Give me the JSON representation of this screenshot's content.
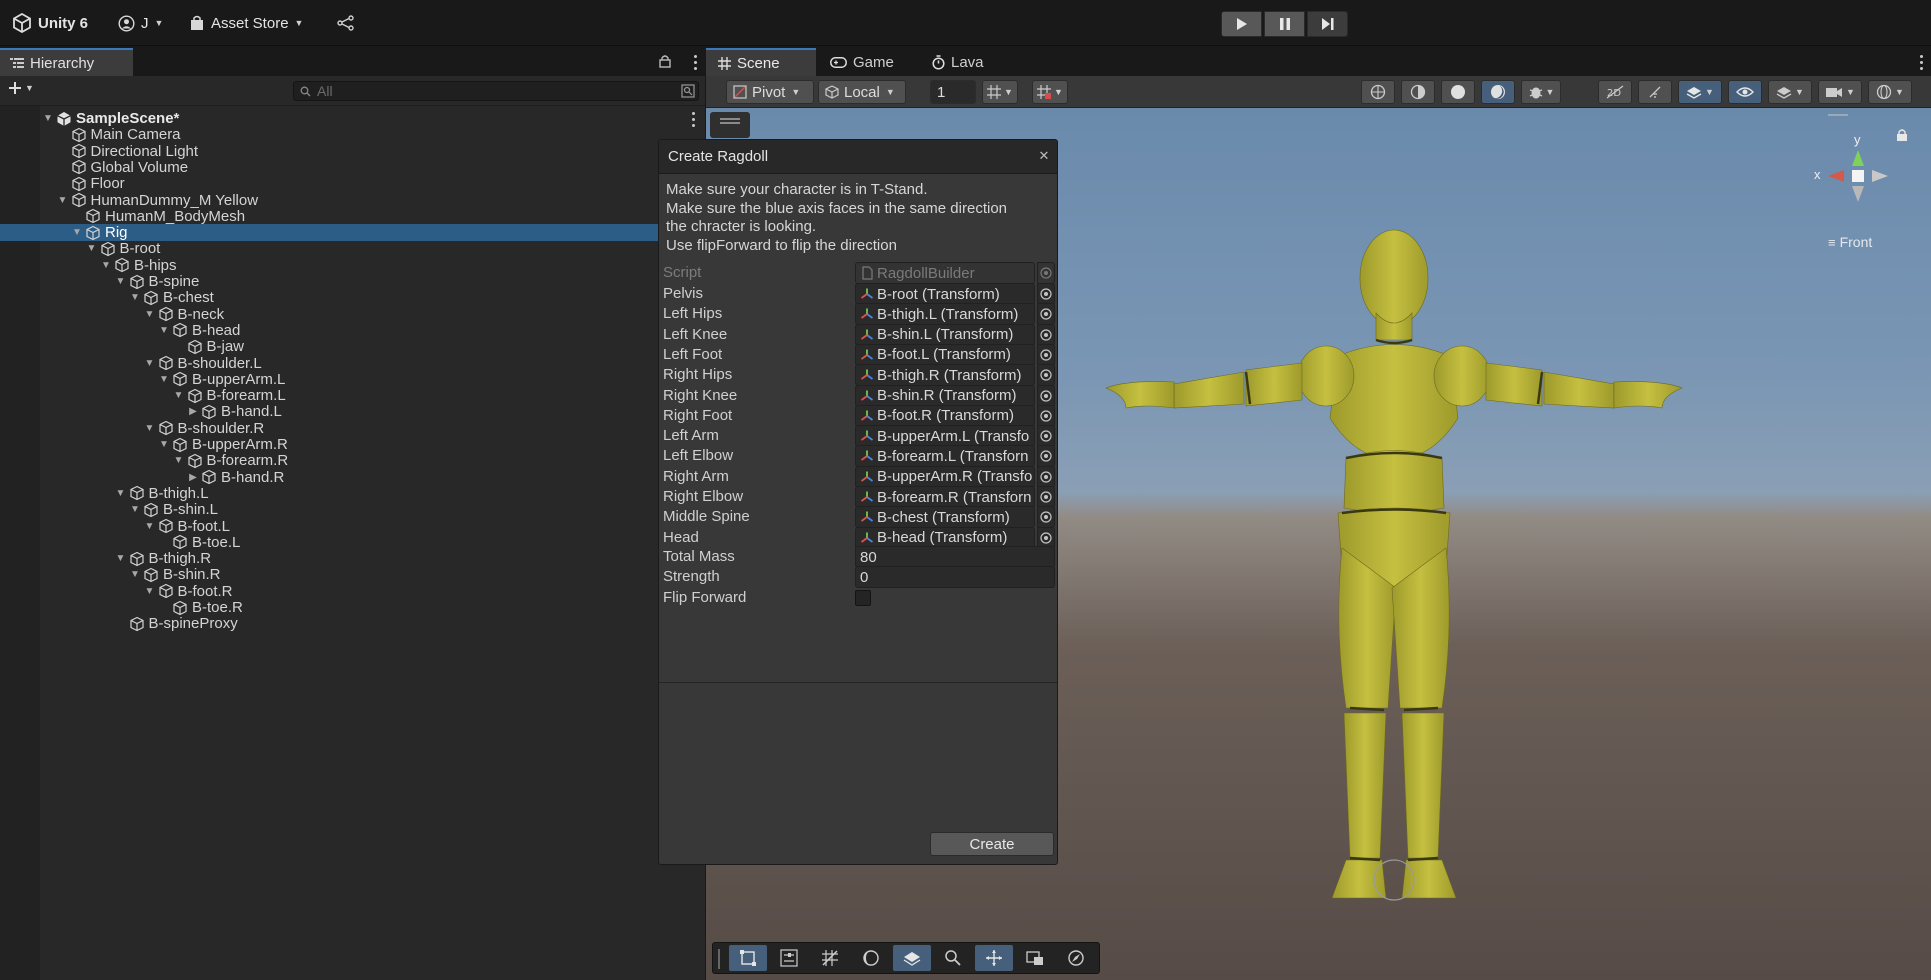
{
  "topbar": {
    "unity_label": "Unity 6",
    "account_label": "J",
    "asset_store_label": "Asset Store"
  },
  "hierarchy": {
    "tab_label": "Hierarchy",
    "search_placeholder": "All",
    "rows": [
      {
        "label": "SampleScene*",
        "depth": 0,
        "arrow": "down",
        "kind": "scene"
      },
      {
        "label": "Main Camera",
        "depth": 1,
        "arrow": "",
        "kind": "go"
      },
      {
        "label": "Directional Light",
        "depth": 1,
        "arrow": "",
        "kind": "go"
      },
      {
        "label": "Global Volume",
        "depth": 1,
        "arrow": "",
        "kind": "go"
      },
      {
        "label": "Floor",
        "depth": 1,
        "arrow": "",
        "kind": "go"
      },
      {
        "label": "HumanDummy_M Yellow",
        "depth": 1,
        "arrow": "down",
        "kind": "go"
      },
      {
        "label": "HumanM_BodyMesh",
        "depth": 2,
        "arrow": "",
        "kind": "go"
      },
      {
        "label": "Rig",
        "depth": 2,
        "arrow": "down",
        "kind": "go",
        "selected": true
      },
      {
        "label": "B-root",
        "depth": 3,
        "arrow": "down",
        "kind": "go"
      },
      {
        "label": "B-hips",
        "depth": 4,
        "arrow": "down",
        "kind": "go"
      },
      {
        "label": "B-spine",
        "depth": 5,
        "arrow": "down",
        "kind": "go"
      },
      {
        "label": "B-chest",
        "depth": 6,
        "arrow": "down",
        "kind": "go"
      },
      {
        "label": "B-neck",
        "depth": 7,
        "arrow": "down",
        "kind": "go"
      },
      {
        "label": "B-head",
        "depth": 8,
        "arrow": "down",
        "kind": "go"
      },
      {
        "label": "B-jaw",
        "depth": 9,
        "arrow": "",
        "kind": "go"
      },
      {
        "label": "B-shoulder.L",
        "depth": 7,
        "arrow": "down",
        "kind": "go"
      },
      {
        "label": "B-upperArm.L",
        "depth": 8,
        "arrow": "down",
        "kind": "go"
      },
      {
        "label": "B-forearm.L",
        "depth": 9,
        "arrow": "down",
        "kind": "go"
      },
      {
        "label": "B-hand.L",
        "depth": 10,
        "arrow": "right",
        "kind": "go"
      },
      {
        "label": "B-shoulder.R",
        "depth": 7,
        "arrow": "down",
        "kind": "go"
      },
      {
        "label": "B-upperArm.R",
        "depth": 8,
        "arrow": "down",
        "kind": "go"
      },
      {
        "label": "B-forearm.R",
        "depth": 9,
        "arrow": "down",
        "kind": "go"
      },
      {
        "label": "B-hand.R",
        "depth": 10,
        "arrow": "right",
        "kind": "go"
      },
      {
        "label": "B-thigh.L",
        "depth": 5,
        "arrow": "down",
        "kind": "go"
      },
      {
        "label": "B-shin.L",
        "depth": 6,
        "arrow": "down",
        "kind": "go"
      },
      {
        "label": "B-foot.L",
        "depth": 7,
        "arrow": "down",
        "kind": "go"
      },
      {
        "label": "B-toe.L",
        "depth": 8,
        "arrow": "",
        "kind": "go"
      },
      {
        "label": "B-thigh.R",
        "depth": 5,
        "arrow": "down",
        "kind": "go"
      },
      {
        "label": "B-shin.R",
        "depth": 6,
        "arrow": "down",
        "kind": "go"
      },
      {
        "label": "B-foot.R",
        "depth": 7,
        "arrow": "down",
        "kind": "go"
      },
      {
        "label": "B-toe.R",
        "depth": 8,
        "arrow": "",
        "kind": "go"
      },
      {
        "label": "B-spineProxy",
        "depth": 5,
        "arrow": "",
        "kind": "go"
      }
    ]
  },
  "scene": {
    "tabs": [
      {
        "label": "Scene",
        "icon": "grid-icon"
      },
      {
        "label": "Game",
        "icon": "gamepad-icon"
      },
      {
        "label": "Lava",
        "icon": "timer-icon"
      }
    ],
    "pivot_label": "Pivot",
    "local_label": "Local",
    "grid_snap_value": "1",
    "orientation_label": "Front",
    "gizmo_y": "y",
    "gizmo_x": "x"
  },
  "ragdoll": {
    "title": "Create Ragdoll",
    "help_lines": [
      "Make sure your character is in T-Stand.",
      "Make sure the blue axis faces in the same direction",
      "the chracter is looking.",
      "Use flipForward to flip the direction"
    ],
    "script_label": "Script",
    "script_value": "RagdollBuilder",
    "fields": [
      {
        "label": "Pelvis",
        "value": "B-root (Transform)"
      },
      {
        "label": "Left Hips",
        "value": "B-thigh.L (Transform)"
      },
      {
        "label": "Left Knee",
        "value": "B-shin.L (Transform)"
      },
      {
        "label": "Left Foot",
        "value": "B-foot.L (Transform)"
      },
      {
        "label": "Right Hips",
        "value": "B-thigh.R (Transform)"
      },
      {
        "label": "Right Knee",
        "value": "B-shin.R (Transform)"
      },
      {
        "label": "Right Foot",
        "value": "B-foot.R (Transform)"
      },
      {
        "label": "Left Arm",
        "value": "B-upperArm.L (Transfo"
      },
      {
        "label": "Left Elbow",
        "value": "B-forearm.L (Transforn"
      },
      {
        "label": "Right Arm",
        "value": "B-upperArm.R (Transfo"
      },
      {
        "label": "Right Elbow",
        "value": "B-forearm.R (Transforn"
      },
      {
        "label": "Middle Spine",
        "value": "B-chest (Transform)"
      },
      {
        "label": "Head",
        "value": "B-head (Transform)"
      }
    ],
    "total_mass_label": "Total Mass",
    "total_mass_value": "80",
    "strength_label": "Strength",
    "strength_value": "0",
    "flip_forward_label": "Flip Forward",
    "flip_forward_checked": false,
    "create_label": "Create"
  },
  "colors": {
    "selection": "#2c5d87",
    "accent_tab": "#3a79bb",
    "dummy_yellow": "#b9b43a"
  }
}
